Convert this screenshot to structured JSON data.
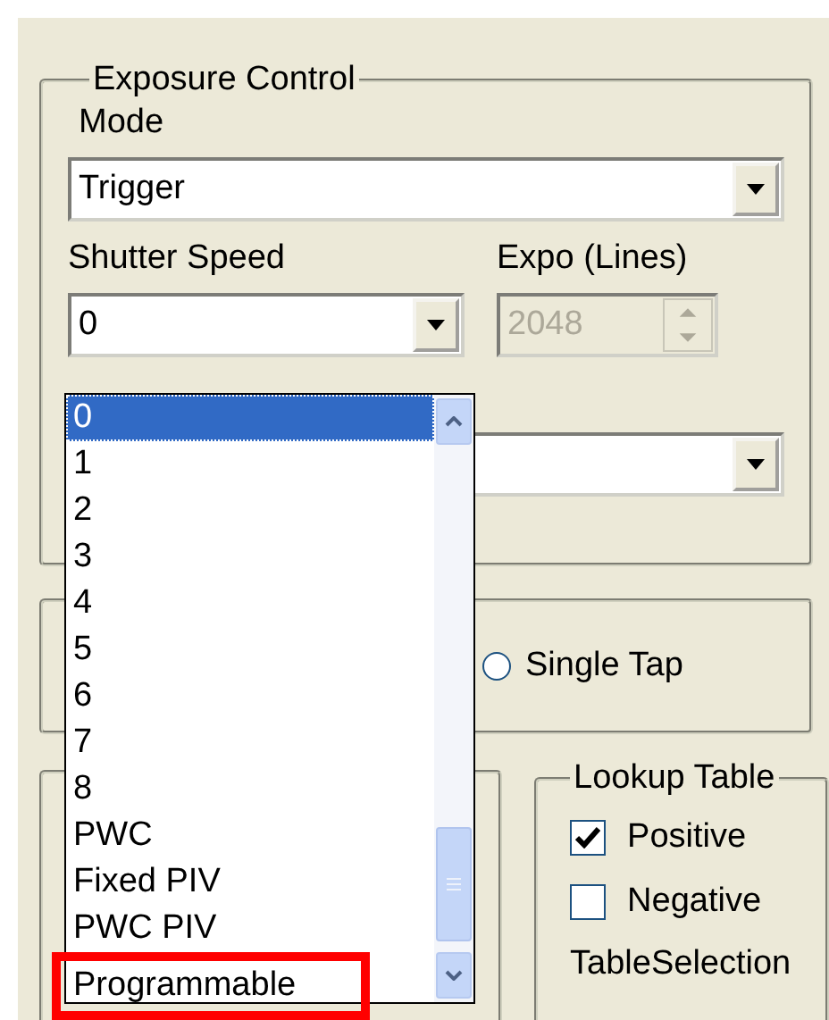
{
  "exposure_control": {
    "title": "Exposure Control",
    "mode_label": "Mode",
    "mode_value": "Trigger",
    "shutter_label": "Shutter Speed",
    "shutter_value": "0",
    "expo_label": "Expo (Lines)",
    "expo_value": "2048",
    "expo_disabled": true
  },
  "shutter_dropdown": {
    "items": [
      {
        "label": "0",
        "selected": true,
        "highlighted": false
      },
      {
        "label": "1",
        "selected": false,
        "highlighted": false
      },
      {
        "label": "2",
        "selected": false,
        "highlighted": false
      },
      {
        "label": "3",
        "selected": false,
        "highlighted": false
      },
      {
        "label": "4",
        "selected": false,
        "highlighted": false
      },
      {
        "label": "5",
        "selected": false,
        "highlighted": false
      },
      {
        "label": "6",
        "selected": false,
        "highlighted": false
      },
      {
        "label": "7",
        "selected": false,
        "highlighted": false
      },
      {
        "label": "8",
        "selected": false,
        "highlighted": false
      },
      {
        "label": "PWC",
        "selected": false,
        "highlighted": false
      },
      {
        "label": "Fixed PIV",
        "selected": false,
        "highlighted": false
      },
      {
        "label": "PWC PIV",
        "selected": false,
        "highlighted": false
      },
      {
        "label": "Programmable",
        "selected": false,
        "highlighted": true
      }
    ]
  },
  "tap_options": [
    {
      "label": "Single Tap",
      "selected": false
    }
  ],
  "lookup_table": {
    "title": "Lookup Table",
    "options": [
      {
        "label": "Positive",
        "checked": true
      },
      {
        "label": "Negative",
        "checked": false
      }
    ],
    "table_selection_label": "TableSelection"
  }
}
